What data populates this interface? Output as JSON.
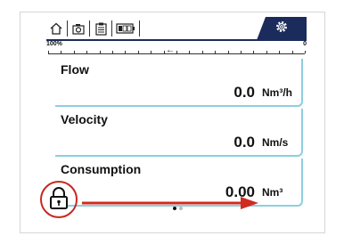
{
  "toolbar": {
    "icons": [
      "home-icon",
      "camera-icon",
      "clipboard-icon",
      "battery-icon"
    ],
    "settings_icon": "gear-icon",
    "accent_color": "#1b2b5c"
  },
  "scale": {
    "left_label": "100%",
    "right_label": "0"
  },
  "measurements": [
    {
      "label": "Flow",
      "value": "0.0",
      "unit": "Nm³/h"
    },
    {
      "label": "Velocity",
      "value": "0.0",
      "unit": "Nm/s"
    },
    {
      "label": "Consumption",
      "value": "0.00",
      "unit": "Nm³"
    }
  ],
  "pagination": {
    "page_count": 2,
    "current_page": 1
  },
  "annotations": {
    "lock_icon": "lock-icon",
    "arrow_icon": "arrow-right-icon",
    "highlight_color": "#c8281f"
  },
  "row_accent_color": "#8ccfe0"
}
